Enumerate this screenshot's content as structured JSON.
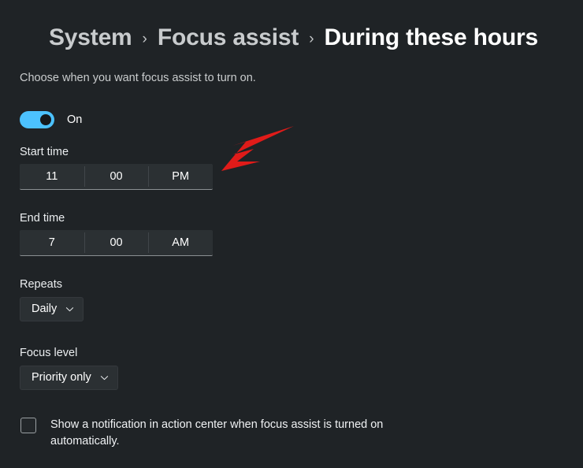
{
  "breadcrumb": {
    "items": [
      {
        "label": "System",
        "current": false
      },
      {
        "label": "Focus assist",
        "current": false
      },
      {
        "label": "During these hours",
        "current": true
      }
    ],
    "separator": "›"
  },
  "page": {
    "subtitle": "Choose when you want focus assist to turn on."
  },
  "enable_toggle": {
    "label": "On",
    "state": "on",
    "accent_color": "#4cc2ff"
  },
  "start_time": {
    "label": "Start time",
    "hour": "11",
    "minute": "00",
    "meridiem": "PM"
  },
  "end_time": {
    "label": "End time",
    "hour": "7",
    "minute": "00",
    "meridiem": "AM"
  },
  "repeats": {
    "label": "Repeats",
    "value": "Daily"
  },
  "focus_level": {
    "label": "Focus level",
    "value": "Priority only"
  },
  "notification_checkbox": {
    "checked": false,
    "label": "Show a notification in action center when focus assist is turned on automatically."
  },
  "annotation": {
    "type": "arrow",
    "color": "#e01b19",
    "points_to": "start-time-meridiem-segment"
  }
}
